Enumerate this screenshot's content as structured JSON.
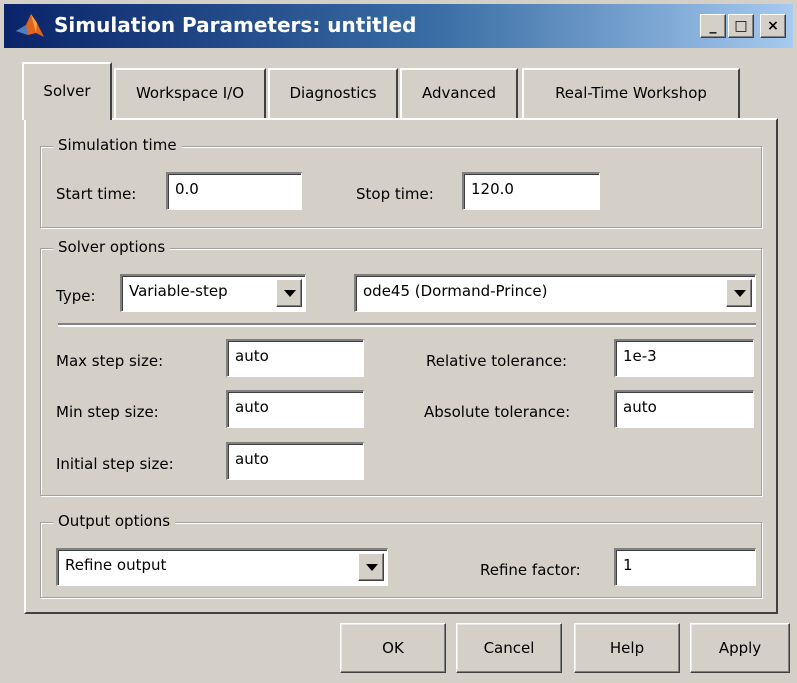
{
  "window": {
    "title": "Simulation Parameters: untitled",
    "controls": {
      "minimize": "_",
      "maximize": "□",
      "close": "×"
    }
  },
  "tabs": [
    {
      "label": "Solver",
      "active": true
    },
    {
      "label": "Workspace I/O",
      "active": false
    },
    {
      "label": "Diagnostics",
      "active": false
    },
    {
      "label": "Advanced",
      "active": false
    },
    {
      "label": "Real-Time Workshop",
      "active": false
    }
  ],
  "simulation_time": {
    "title": "Simulation time",
    "start_label": "Start time:",
    "start_value": "0.0",
    "stop_label": "Stop time:",
    "stop_value": "120.0"
  },
  "solver_options": {
    "title": "Solver options",
    "type_label": "Type:",
    "type_value": "Variable-step",
    "solver_value": "ode45 (Dormand-Prince)",
    "max_step_label": "Max step size:",
    "max_step_value": "auto",
    "min_step_label": "Min step size:",
    "min_step_value": "auto",
    "initial_step_label": "Initial step size:",
    "initial_step_value": "auto",
    "rel_tol_label": "Relative tolerance:",
    "rel_tol_value": "1e-3",
    "abs_tol_label": "Absolute tolerance:",
    "abs_tol_value": "auto"
  },
  "output_options": {
    "title": "Output options",
    "output_value": "Refine output",
    "refine_label": "Refine factor:",
    "refine_value": "1"
  },
  "buttons": {
    "ok": "OK",
    "cancel": "Cancel",
    "help": "Help",
    "apply": "Apply"
  },
  "icon": "matlab-logo-icon"
}
